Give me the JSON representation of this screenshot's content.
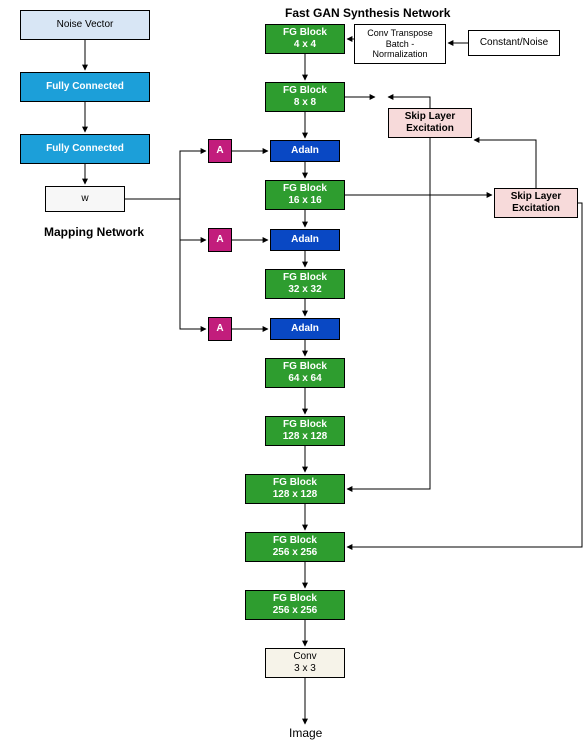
{
  "titles": {
    "main": "Fast GAN Synthesis Network",
    "mapping": "Mapping Network",
    "image": "Image"
  },
  "mapping": {
    "noise": "Noise Vector",
    "fc1": "Fully Connected",
    "fc2": "Fully Connected",
    "w": "w"
  },
  "a": {
    "a1": "A",
    "a2": "A",
    "a3": "A"
  },
  "adain": {
    "ad1": "AdaIn",
    "ad2": "AdaIn",
    "ad3": "AdaIn"
  },
  "fg": {
    "b4": {
      "t": "FG Block",
      "s": "4 x 4"
    },
    "b8": {
      "t": "FG Block",
      "s": "8 x 8"
    },
    "b16": {
      "t": "FG Block",
      "s": "16 x 16"
    },
    "b32": {
      "t": "FG Block",
      "s": "32 x 32"
    },
    "b64": {
      "t": "FG Block",
      "s": "64 x 64"
    },
    "b128a": {
      "t": "FG Block",
      "s": "128 x 128"
    },
    "b128b": {
      "t": "FG Block",
      "s": "128 x 128"
    },
    "b256a": {
      "t": "FG Block",
      "s": "256 x 256"
    },
    "b256b": {
      "t": "FG Block",
      "s": "256 x 256"
    }
  },
  "conv": {
    "t": "Conv",
    "s": "3 x 3"
  },
  "right": {
    "detail": "Conv Transpose\nBatch -\nNormalization",
    "const": "Constant/Noise",
    "sle1": {
      "t": "Skip Layer",
      "s": "Excitation"
    },
    "sle2": {
      "t": "Skip Layer",
      "s": "Excitation"
    }
  },
  "colors": {
    "green": "#2e9d2f",
    "blue": "#0948c4",
    "cyan": "#1c9fd9",
    "magenta": "#c21d7c",
    "pink": "#f7dada",
    "lightblue": "#d8e6f5"
  }
}
